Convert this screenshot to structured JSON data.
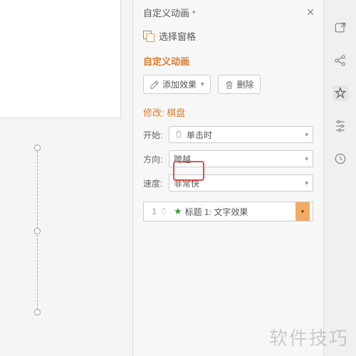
{
  "panel": {
    "title": "自定义动画",
    "selection_pane": "选择窗格",
    "section_title": "自定义动画",
    "add_effect": "添加效果",
    "delete": "删除",
    "modify_label": "修改: 棋盘",
    "start_label": "开始:",
    "start_value": "单击时",
    "direction_label": "方向:",
    "direction_value": "跨越",
    "speed_label": "速度:",
    "speed_value": "非常快"
  },
  "animation_list": {
    "items": [
      {
        "index": "1",
        "title": "标题 1: 文字效果"
      }
    ]
  },
  "watermark": "软件技巧"
}
